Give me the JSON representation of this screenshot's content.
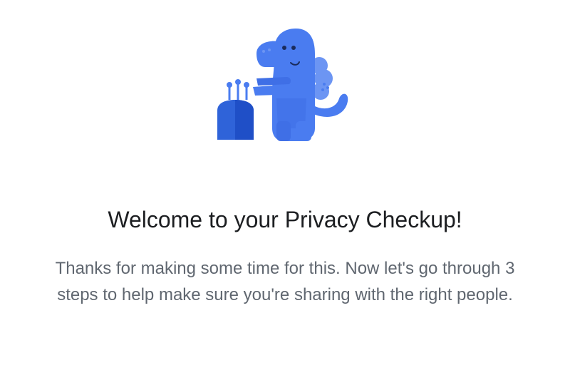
{
  "illustration": {
    "icon": "privacy-dinosaur-icon",
    "colors": {
      "body": "#4a7cf0",
      "belly": "#3f6fe6",
      "spikes": "#6c95f3",
      "device": "#2f63d9",
      "device_dark": "#1f4fc7",
      "eye": "#1a2b5c"
    }
  },
  "welcome": {
    "title": "Welcome to your Privacy Checkup!",
    "body": "Thanks for making some time for this. Now let's go through 3 steps to help make sure you're sharing with the right people."
  },
  "colors": {
    "background": "#ffffff",
    "title_text": "#1c1e21",
    "body_text": "#606770"
  }
}
